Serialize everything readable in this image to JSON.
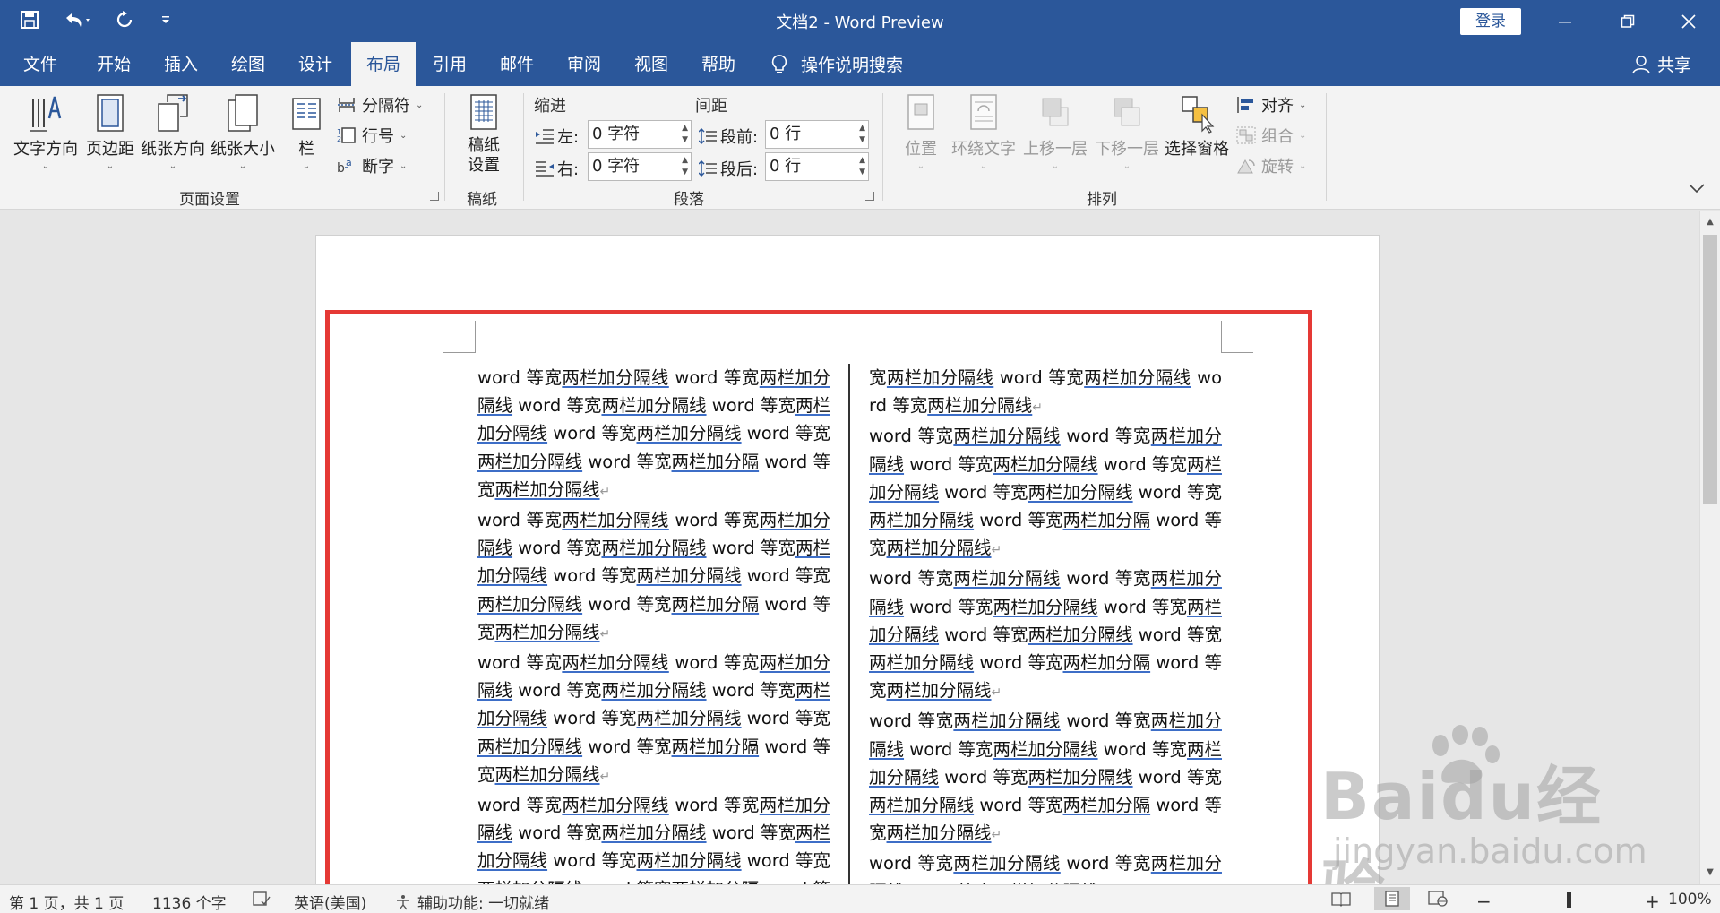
{
  "window": {
    "title": "文档2  -  Word Preview",
    "login_label": "登录"
  },
  "tabs": [
    {
      "label": "文件"
    },
    {
      "label": "开始"
    },
    {
      "label": "插入"
    },
    {
      "label": "绘图"
    },
    {
      "label": "设计"
    },
    {
      "label": "布局",
      "active": true
    },
    {
      "label": "引用"
    },
    {
      "label": "邮件"
    },
    {
      "label": "审阅"
    },
    {
      "label": "视图"
    },
    {
      "label": "帮助"
    }
  ],
  "tell_me": "操作说明搜索",
  "share": "共享",
  "ribbon": {
    "page_setup": {
      "text_direction": "文字方向",
      "margins": "页边距",
      "orientation": "纸张方向",
      "size": "纸张大小",
      "columns": "栏",
      "breaks": "分隔符",
      "line_numbers": "行号",
      "hyphenation": "断字",
      "group_label": "页面设置"
    },
    "manuscript": {
      "setup_line1": "稿纸",
      "setup_line2": "设置",
      "group_label": "稿纸"
    },
    "paragraph": {
      "indent_head": "缩进",
      "spacing_head": "间距",
      "left_label": "左:",
      "right_label": "右:",
      "before_label": "段前:",
      "after_label": "段后:",
      "left_value": "0 字符",
      "right_value": "0 字符",
      "before_value": "0 行",
      "after_value": "0 行",
      "group_label": "段落"
    },
    "arrange": {
      "position": "位置",
      "wrap_text": "环绕文字",
      "bring_forward": "上移一层",
      "send_backward": "下移一层",
      "selection_pane": "选择窗格",
      "align": "对齐",
      "group": "组合",
      "rotate": "旋转",
      "group_label": "排列"
    }
  },
  "document": {
    "left_column": [
      {
        "text": "word 等宽两栏加分隔线 word 等宽两栏加分隔线 word 等宽两栏加分隔线 word 等宽两栏加分隔线 word 等宽两栏加分隔线 word 等宽两栏加分隔线 word 等宽两栏加分隔 word 等宽两栏加分隔线"
      },
      {
        "text": "word 等宽两栏加分隔线 word 等宽两栏加分隔线 word 等宽两栏加分隔线 word 等宽两栏加分隔线 word 等宽两栏加分隔线 word 等宽两栏加分隔线 word 等宽两栏加分隔 word 等宽两栏加分隔线"
      },
      {
        "text": "word 等宽两栏加分隔线 word 等宽两栏加分隔线 word 等宽两栏加分隔线 word 等宽两栏加分隔线 word 等宽两栏加分隔线 word 等宽两栏加分隔线 word 等宽两栏加分隔 word 等宽两栏加分隔线"
      },
      {
        "text": "word 等宽两栏加分隔线 word 等宽两栏加分隔线 word 等宽两栏加分隔线 word 等宽两栏加分隔线 word 等宽两栏加分隔线 word 等宽两栏加分隔线 word 等宽两栏加分隔 word 等宽两栏加分隔线"
      }
    ],
    "right_column": [
      {
        "text": "宽两栏加分隔线 word 等宽两栏加分隔线 word 等宽两栏加分隔线"
      },
      {
        "text": "word 等宽两栏加分隔线 word 等宽两栏加分隔线 word 等宽两栏加分隔线 word 等宽两栏加分隔线 word 等宽两栏加分隔线 word 等宽两栏加分隔线 word 等宽两栏加分隔 word 等宽两栏加分隔线"
      },
      {
        "text": "word 等宽两栏加分隔线 word 等宽两栏加分隔线 word 等宽两栏加分隔线 word 等宽两栏加分隔线 word 等宽两栏加分隔线 word 等宽两栏加分隔线 word 等宽两栏加分隔 word 等宽两栏加分隔线"
      },
      {
        "text": "word 等宽两栏加分隔线 word 等宽两栏加分隔线 word 等宽两栏加分隔线 word 等宽两栏加分隔线 word 等宽两栏加分隔线 word 等宽两栏加分隔线 word 等宽两栏加分隔 word 等宽两栏加分隔线"
      },
      {
        "text": "word 等宽两栏加分隔线 word 等宽两栏加分隔线 word 等宽两栏加分隔线"
      }
    ]
  },
  "status": {
    "page": "第 1 页，共 1 页",
    "words": "1136 个字",
    "language": "英语(美国)",
    "accessibility": "辅助功能: 一切就绪",
    "zoom": "100%",
    "zoom_level": 0.5
  },
  "watermark": {
    "brand": "Baidu经验",
    "url": "jingyan.baidu.com"
  },
  "colors": {
    "accent": "#2b579a",
    "highlight_box": "#e53935",
    "underline": "#3d6ec7"
  }
}
